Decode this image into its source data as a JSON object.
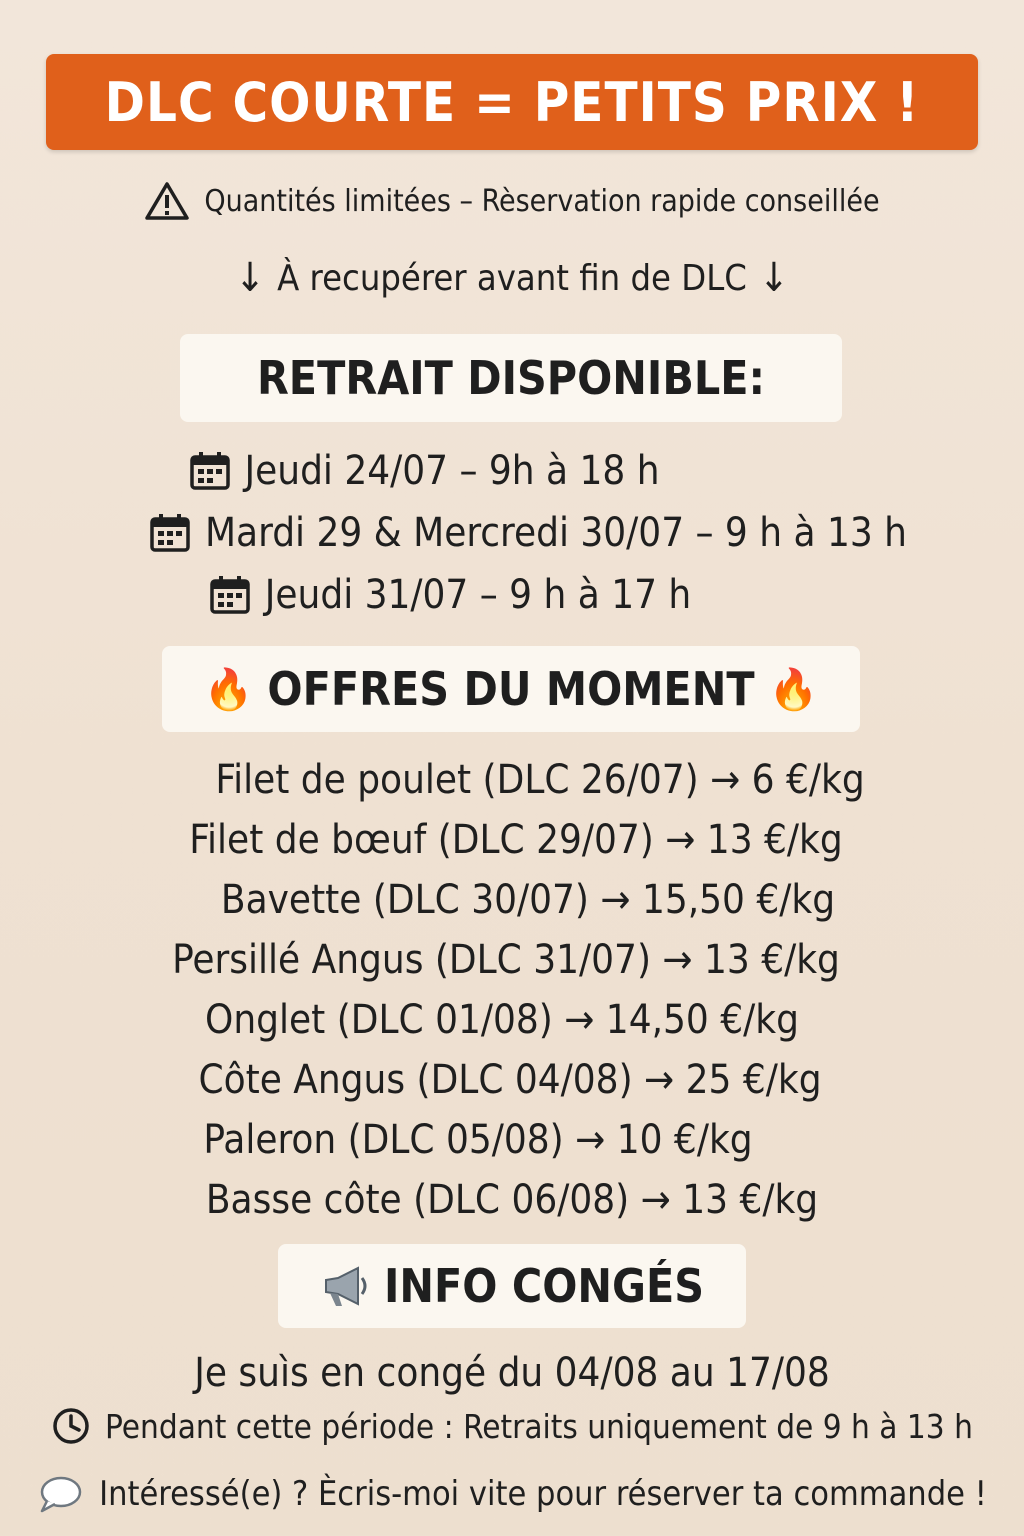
{
  "header": {
    "banner_title": "DLC COURTE = PETITS PRIX !",
    "warning_text": "Quantités limitées – Rèservation rapide conseillée",
    "recup_text": "À recupérer avant fin de DLC",
    "colors": {
      "banner_bg": "#e0601b",
      "banner_text": "#ffffff",
      "background": "#f2e6da"
    }
  },
  "retrait": {
    "title": "RETRAIT DISPONIBLE:",
    "dates": [
      {
        "text": "Jeudi 24/07 – 9h à 18 h",
        "icon": "calendar-icon"
      },
      {
        "text": "Mardi 29 & Mercredi 30/07 – 9 h à 13 h",
        "icon": "calendar-icon"
      },
      {
        "text": "Jeudi 31/07 – 9 h à 17 h",
        "icon": "calendar-icon"
      }
    ]
  },
  "offres": {
    "title": "OFFRES DU MOMENT",
    "icon": "fire-icon",
    "items": [
      {
        "text": "Filet de poulet (DLC 26/07) → 6 €/kg"
      },
      {
        "text": "Filet de bœuf (DLC 29/07) → 13 €/kg"
      },
      {
        "text": "Bavette (DLC 30/07) → 15,50 €/kg"
      },
      {
        "text": "Persillé Angus (DLC 31/07) → 13 €/kg"
      },
      {
        "text": "Onglet (DLC 01/08) → 14,50 €/kg"
      },
      {
        "text": "Côte Angus (DLC 04/08) → 25 €/kg"
      },
      {
        "text": "Paleron (DLC 05/08) → 10 €/kg"
      },
      {
        "text": "Basse côte (DLC 06/08) → 13 €/kg"
      }
    ]
  },
  "conges": {
    "title": "INFO CONGÉS",
    "icon": "megaphone-icon",
    "line": "Je suìs en congé du 04/08 au 17/08",
    "period": "Pendant cette période : Retraits uniquement de 9 h à 13 h",
    "contact": "Intéressé(e) ? Ècris-moi vite pour réserver ta commande !"
  }
}
